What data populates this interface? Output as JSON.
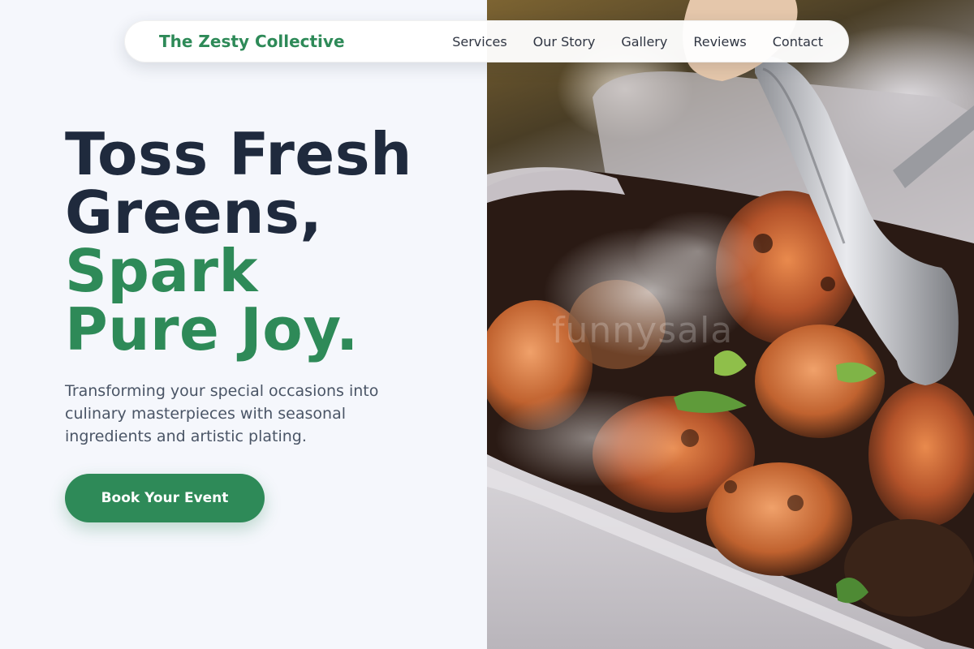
{
  "brand": {
    "name": "The Zesty Collective",
    "color": "#2e8a58"
  },
  "nav": {
    "items": [
      {
        "label": "Services"
      },
      {
        "label": "Our Story"
      },
      {
        "label": "Gallery"
      },
      {
        "label": "Reviews"
      },
      {
        "label": "Contact"
      }
    ]
  },
  "hero": {
    "headline_lines": [
      {
        "text": "Toss Fresh",
        "tone": "dark"
      },
      {
        "text": "Greens,",
        "tone": "dark"
      },
      {
        "text": "Spark",
        "tone": "green"
      },
      {
        "text": "Pure Joy.",
        "tone": "green"
      }
    ],
    "subtext": "Transforming your special occasions into culinary masterpieces with seasonal ingredients and artistic plating.",
    "cta_label": "Book Your Event",
    "image_watermark": "funnysala"
  },
  "colors": {
    "accent": "#2e8a58",
    "headline_dark": "#1f2a3d",
    "body_text": "#4a5566",
    "background": "#f5f7fc"
  },
  "icons": {
    "hero_image": "grilled-shrimp-tongs-photo"
  }
}
